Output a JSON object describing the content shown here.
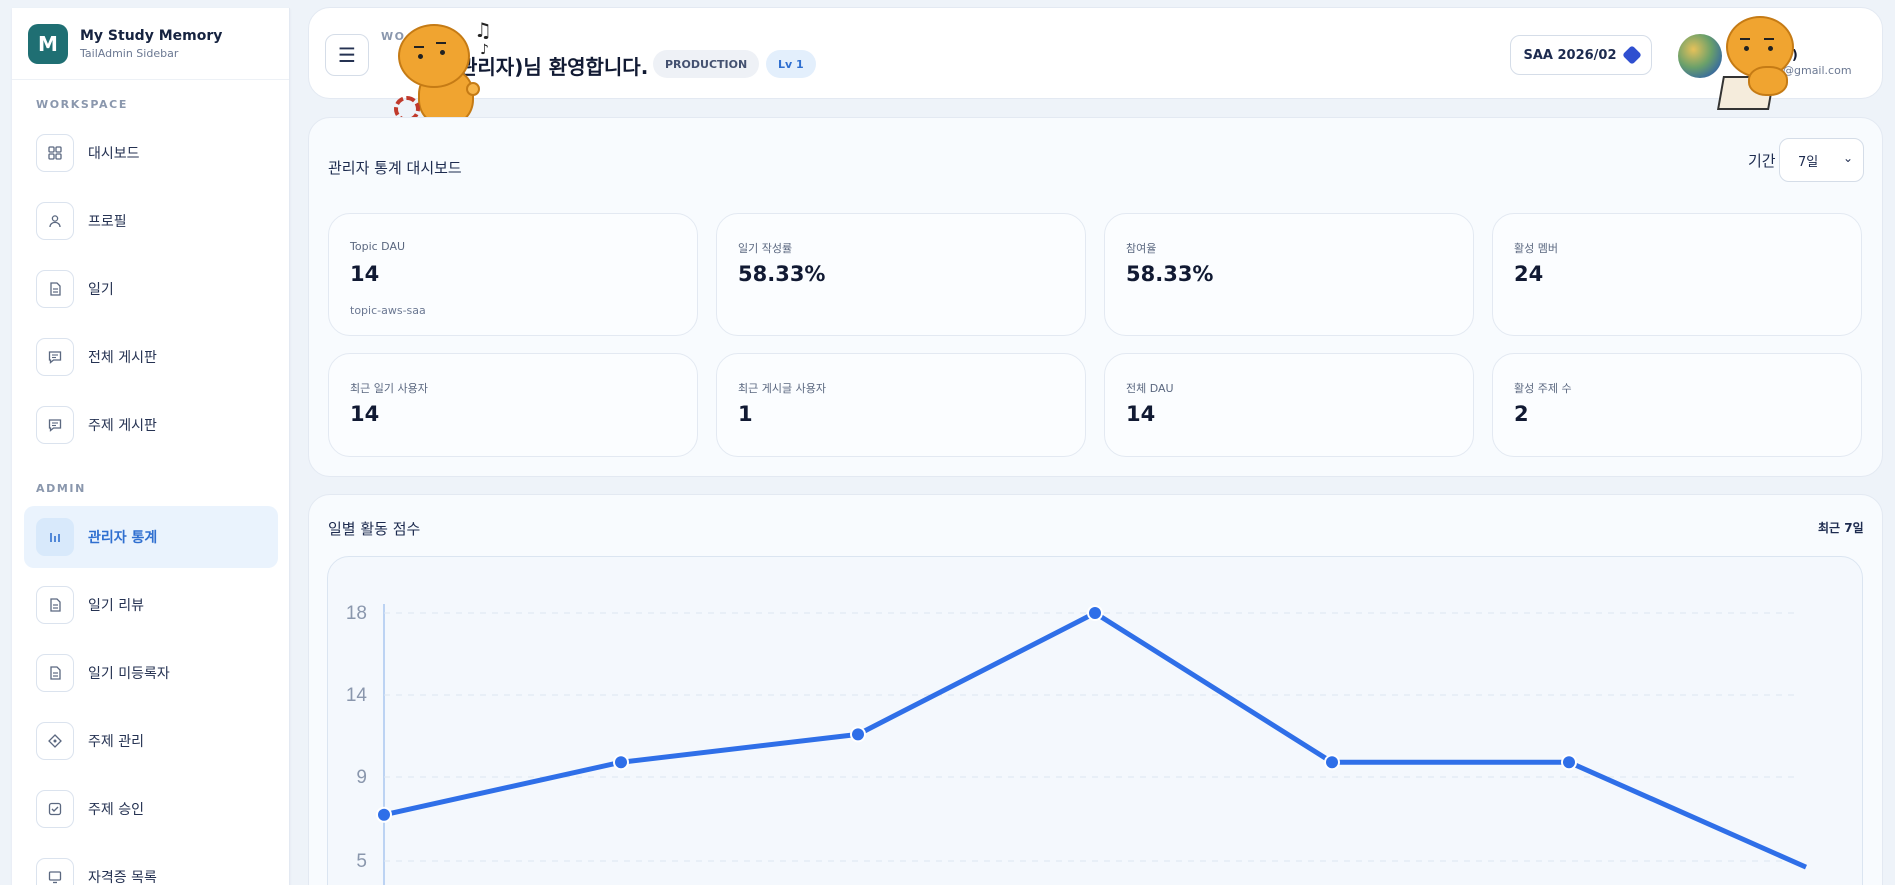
{
  "brand": {
    "title": "My Study Memory",
    "subtitle": "TailAdmin Sidebar",
    "logo_letter": "M"
  },
  "sidebar": {
    "workspace_label": "WORKSPACE",
    "admin_label": "ADMIN",
    "workspace_items": [
      {
        "label": "대시보드",
        "icon": "grid-icon"
      },
      {
        "label": "프로필",
        "icon": "user-icon"
      },
      {
        "label": "일기",
        "icon": "document-icon"
      },
      {
        "label": "전체 게시판",
        "icon": "chat-icon"
      },
      {
        "label": "주제 게시판",
        "icon": "chat-icon"
      }
    ],
    "admin_items": [
      {
        "label": "관리자 통계",
        "icon": "bar-chart-icon",
        "active": true
      },
      {
        "label": "일기 리뷰",
        "icon": "document-icon"
      },
      {
        "label": "일기 미등록자",
        "icon": "document-icon"
      },
      {
        "label": "주제 관리",
        "icon": "diamond-icon"
      },
      {
        "label": "주제 승인",
        "icon": "check-square-icon"
      },
      {
        "label": "자격증 목록",
        "icon": "monitor-icon"
      }
    ]
  },
  "header": {
    "workspace_label": "WO...",
    "welcome": "관리자)님 환영합니다.",
    "env_badge": "PRODUCTION",
    "level_badge": "Lv 1",
    "saa_button": "SAA 2026/02",
    "profile_name": "리자)",
    "profile_email": "2@gmail.com"
  },
  "stats": {
    "title": "관리자 통계 대시보드",
    "period_label": "기간",
    "period_value": "7일",
    "cards": [
      {
        "label": "Topic DAU",
        "value": "14",
        "sub": "topic-aws-saa"
      },
      {
        "label": "일기 작성률",
        "value": "58.33%"
      },
      {
        "label": "참여율",
        "value": "58.33%"
      },
      {
        "label": "활성 멤버",
        "value": "24"
      },
      {
        "label": "최근 일기 사용자",
        "value": "14"
      },
      {
        "label": "최근 게시글 사용자",
        "value": "1"
      },
      {
        "label": "전체 DAU",
        "value": "14"
      },
      {
        "label": "활성 주제 수",
        "value": "2"
      }
    ]
  },
  "chart_panel": {
    "title": "일별 활동 점수",
    "range_label": "최근 7일"
  },
  "chart_data": {
    "type": "line",
    "title": "일별 활동 점수",
    "y_ticks": [
      "18",
      "14",
      "9",
      "5"
    ],
    "ylim": [
      5,
      18
    ],
    "x": [
      1,
      2,
      3,
      4,
      5,
      6,
      7
    ],
    "values": [
      7.2,
      9.9,
      11.6,
      18,
      9.9,
      9.9,
      4.7
    ],
    "color": "#2f6fe8",
    "grid": true
  },
  "colors": {
    "accent": "#2f6fd0",
    "brand": "#1f6f73",
    "line": "#2f6fe8"
  }
}
